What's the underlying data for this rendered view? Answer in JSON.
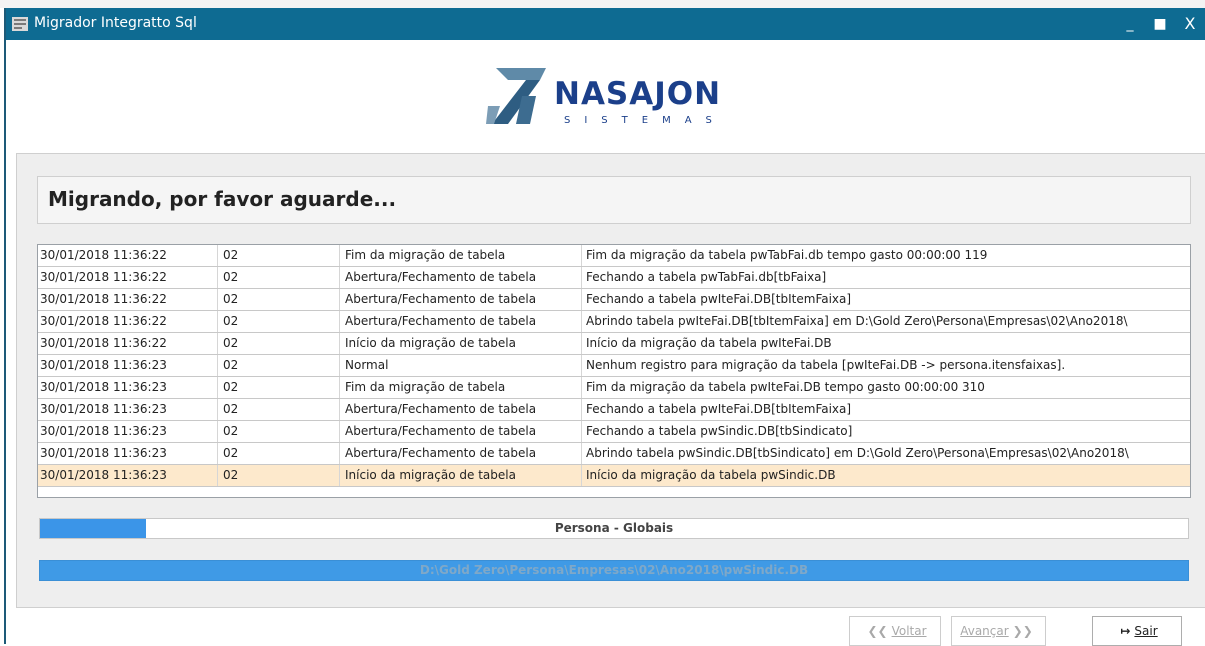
{
  "window": {
    "title": "Migrador Integratto Sql",
    "controls": {
      "minimize": "_",
      "maximize": "■",
      "close": "X"
    }
  },
  "logo": {
    "name": "NASAJON",
    "subtitle": "SISTEMAS",
    "colors": {
      "mark": "#3a6a8f",
      "text": "#1b3f8a"
    }
  },
  "heading": "Migrando, por favor aguarde...",
  "log": {
    "rows": [
      [
        "30/01/2018 11:36:22",
        "02",
        "Fim da migração de tabela",
        "Fim da migração da tabela pwTabFai.db tempo gasto 00:00:00 119"
      ],
      [
        "30/01/2018 11:36:22",
        "02",
        "Abertura/Fechamento de tabela",
        "Fechando a tabela pwTabFai.db[tbFaixa]"
      ],
      [
        "30/01/2018 11:36:22",
        "02",
        "Abertura/Fechamento de tabela",
        "Fechando a tabela pwIteFai.DB[tbItemFaixa]"
      ],
      [
        "30/01/2018 11:36:22",
        "02",
        "Abertura/Fechamento de tabela",
        "Abrindo tabela pwIteFai.DB[tbItemFaixa] em D:\\Gold Zero\\Persona\\Empresas\\02\\Ano2018\\"
      ],
      [
        "30/01/2018 11:36:22",
        "02",
        "Início da migração de tabela",
        "Início da migração da tabela pwIteFai.DB"
      ],
      [
        "30/01/2018 11:36:23",
        "02",
        "Normal",
        "Nenhum registro para migração da tabela [pwIteFai.DB -> persona.itensfaixas]."
      ],
      [
        "30/01/2018 11:36:23",
        "02",
        "Fim da migração de tabela",
        "Fim da migração da tabela pwIteFai.DB tempo gasto 00:00:00 310"
      ],
      [
        "30/01/2018 11:36:23",
        "02",
        "Abertura/Fechamento de tabela",
        "Fechando a tabela pwIteFai.DB[tbItemFaixa]"
      ],
      [
        "30/01/2018 11:36:23",
        "02",
        "Abertura/Fechamento de tabela",
        "Fechando a tabela pwSindic.DB[tbSindicato]"
      ],
      [
        "30/01/2018 11:36:23",
        "02",
        "Abertura/Fechamento de tabela",
        "Abrindo tabela pwSindic.DB[tbSindicato] em D:\\Gold Zero\\Persona\\Empresas\\02\\Ano2018\\"
      ],
      [
        "30/01/2018 11:36:23",
        "02",
        "Início da migração de tabela",
        "Início da migração da tabela pwSindic.DB"
      ]
    ],
    "selected_row": 10,
    "selected_color": "#fde9cc"
  },
  "progress_overall": {
    "label": "Persona - Globais",
    "fraction": 0.092,
    "color": "#3b95e8"
  },
  "progress_file": {
    "label": "D:\\Gold Zero\\Persona\\Empresas\\02\\Ano2018\\pwSindic.DB",
    "fraction": 1.0,
    "color": "#3f9ae6"
  },
  "buttons": {
    "back": {
      "label": "Voltar",
      "icon": "double-chevron-left-icon",
      "enabled": false
    },
    "next": {
      "label": "Avançar",
      "icon": "double-chevron-right-icon",
      "enabled": false
    },
    "exit": {
      "label": "Sair",
      "icon": "exit-icon",
      "enabled": true
    }
  },
  "colors": {
    "titlebar": "#0e6b92",
    "panel": "#eeeeee"
  }
}
